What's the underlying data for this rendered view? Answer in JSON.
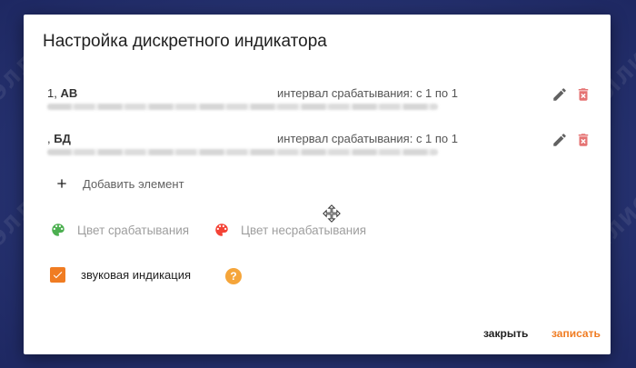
{
  "dialog": {
    "title": "Настройка дискретного индикатора"
  },
  "elements": [
    {
      "index": "1,",
      "name": "АВ",
      "interval": "интервал срабатывания: с 1 по 1",
      "description": "(blurred)"
    },
    {
      "index": ",",
      "name": "БД",
      "interval": "интервал срабатывания: с 1 по 1",
      "description": "(blurred)"
    }
  ],
  "add_element_label": "Добавить элемент",
  "colors": {
    "trigger_label": "Цвет срабатывания",
    "trigger_color": "#4caf50",
    "no_trigger_label": "Цвет несрабатывания",
    "no_trigger_color": "#f44336"
  },
  "sound": {
    "label": "звуковая индикация",
    "checked": true,
    "help_symbol": "?"
  },
  "buttons": {
    "close": "закрыть",
    "save": "записать"
  },
  "theme": {
    "accent": "#f07c22",
    "delete_icon_color": "#e57373",
    "edit_icon_color": "#616161",
    "backdrop": "#2d3a78"
  }
}
